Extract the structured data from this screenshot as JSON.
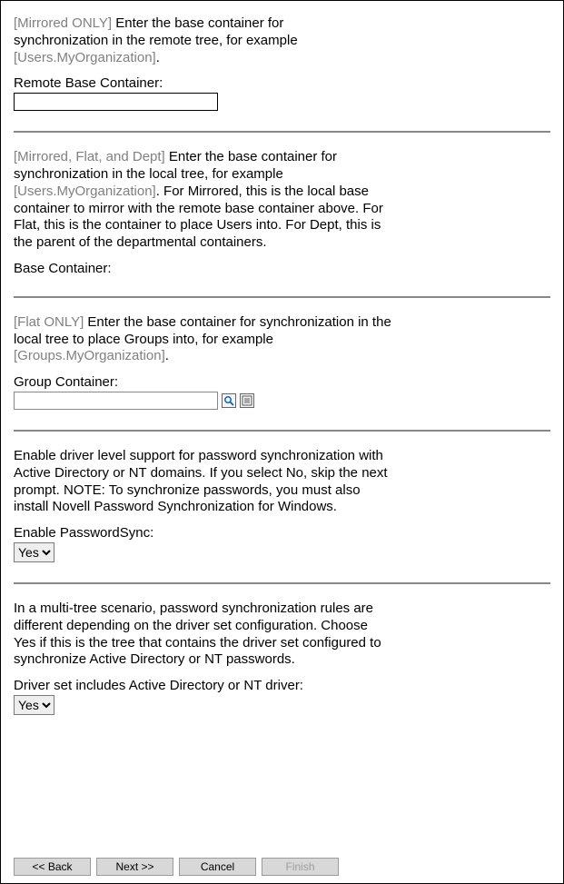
{
  "section1": {
    "tag": "[Mirrored ONLY]",
    "desc_a": " Enter the base container for synchronization in the remote tree, for example ",
    "example": "[Users.MyOrganization]",
    "desc_b": ".",
    "label": "Remote Base Container:",
    "value": ""
  },
  "section2": {
    "tag": "[Mirrored, Flat, and Dept]",
    "desc_a": " Enter the base container for synchronization in the local tree, for example ",
    "example": "[Users.MyOrganization]",
    "desc_b": ". For Mirrored, this is the local base container to mirror with the remote base container above. For Flat, this is the container to place Users into. For Dept, this is the parent of the departmental containers.",
    "label": "Base Container:"
  },
  "section3": {
    "tag": "[Flat ONLY]",
    "desc_a": " Enter the base container for synchronization in the local tree to place Groups into, for example ",
    "example": "[Groups.MyOrganization]",
    "desc_b": ".",
    "label": "Group Container:",
    "value": ""
  },
  "section4": {
    "desc": "Enable driver level support for password synchronization with Active Directory or NT domains. If you select No, skip the next prompt. NOTE: To synchronize passwords, you must also install Novell Password Synchronization for Windows.",
    "label": "Enable PasswordSync:",
    "value": "Yes"
  },
  "section5": {
    "desc": "In a multi-tree scenario, password synchronization rules are different depending on the driver set configuration.  Choose Yes if this is the tree that contains the driver set configured to synchronize Active Directory or NT passwords.",
    "label": "Driver set includes Active Directory or NT driver:",
    "value": "Yes"
  },
  "footer": {
    "back": "<<  Back",
    "next": "Next  >>",
    "cancel": "Cancel",
    "finish": "Finish"
  }
}
